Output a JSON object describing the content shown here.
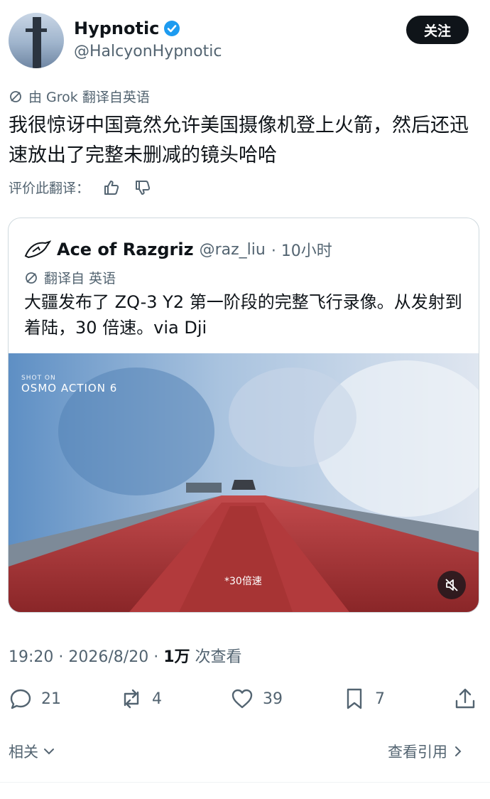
{
  "author": {
    "display_name": "Hypnotic",
    "handle": "@HalcyonHypnotic",
    "follow_label": "关注"
  },
  "translation": {
    "note": "由 Grok 翻译自英语",
    "text": "我很惊讶中国竟然允许美国摄像机登上火箭，然后还迅速放出了完整未删减的镜头哈哈",
    "rate_label": "评价此翻译："
  },
  "quote": {
    "name": "Ace of Razgriz",
    "handle": "@raz_liu",
    "time": "· 10小时",
    "translated_note": "翻译自 英语",
    "text": "大疆发布了 ZQ-3 Y2 第一阶段的完整飞行录像。从发射到着陆，30 倍速。via Dji",
    "media": {
      "shot_on_small": "SHOT ON",
      "shot_on_big": "OSMO ACTION 6",
      "speed_label": "*30倍速"
    }
  },
  "meta": {
    "time": "19:20",
    "date": "2026/8/20",
    "views_count": "1万",
    "views_label": "次查看"
  },
  "actions": {
    "replies": "21",
    "reposts": "4",
    "likes": "39",
    "bookmarks": "7"
  },
  "footer": {
    "related": "相关",
    "view_quotes": "查看引用"
  },
  "colors": {
    "text": "#0f1419",
    "secondary": "#536471",
    "verified": "#1d9bf0",
    "button": "#0f1419",
    "rocket": "#b23a3c"
  },
  "icons": [
    "verified-badge-icon",
    "globe-icon",
    "thumbs-up-icon",
    "thumbs-down-icon",
    "mute-icon",
    "reply-icon",
    "repost-icon",
    "like-icon",
    "bookmark-icon",
    "share-icon",
    "chevron-down-icon",
    "chevron-right-icon"
  ]
}
